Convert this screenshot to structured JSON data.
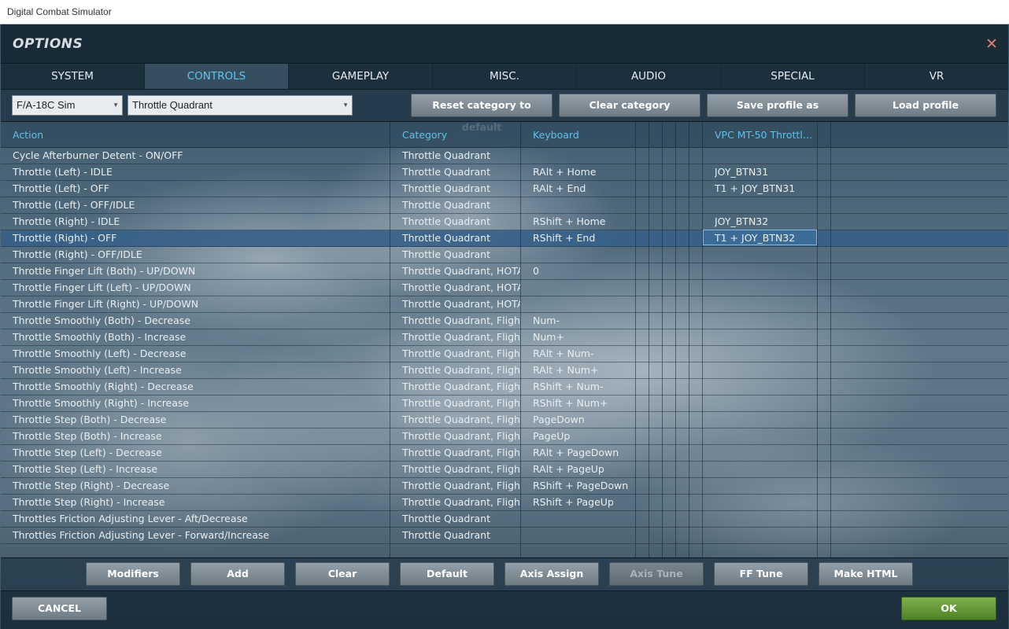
{
  "window_title": "Digital Combat Simulator",
  "dialog": {
    "title": "OPTIONS",
    "close_glyph": "✕"
  },
  "tabs": [
    {
      "label": "SYSTEM",
      "active": false
    },
    {
      "label": "CONTROLS",
      "active": true
    },
    {
      "label": "GAMEPLAY",
      "active": false
    },
    {
      "label": "MISC.",
      "active": false
    },
    {
      "label": "AUDIO",
      "active": false
    },
    {
      "label": "SPECIAL",
      "active": false
    },
    {
      "label": "VR",
      "active": false
    }
  ],
  "toolbar": {
    "aircraft_select": "F/A-18C Sim",
    "category_select": "Throttle Quadrant",
    "reset_label": "Reset category to default",
    "clear_category_label": "Clear category",
    "save_profile_label": "Save profile as",
    "load_profile_label": "Load profile"
  },
  "table": {
    "columns": [
      "Action",
      "Category",
      "Keyboard",
      "VPC MT-50 Throttle ..."
    ],
    "selected_row": 5,
    "rows": [
      [
        "Cycle Afterburner Detent - ON/OFF",
        "Throttle Quadrant",
        "",
        ""
      ],
      [
        "Throttle (Left) - IDLE",
        "Throttle Quadrant",
        "RAlt + Home",
        "JOY_BTN31"
      ],
      [
        "Throttle (Left) - OFF",
        "Throttle Quadrant",
        "RAlt + End",
        "T1 + JOY_BTN31"
      ],
      [
        "Throttle (Left) - OFF/IDLE",
        "Throttle Quadrant",
        "",
        ""
      ],
      [
        "Throttle (Right) - IDLE",
        "Throttle Quadrant",
        "RShift + Home",
        "JOY_BTN32"
      ],
      [
        "Throttle (Right) - OFF",
        "Throttle Quadrant",
        "RShift + End",
        "T1 + JOY_BTN32"
      ],
      [
        "Throttle (Right) - OFF/IDLE",
        "Throttle Quadrant",
        "",
        ""
      ],
      [
        "Throttle Finger Lift (Both) - UP/DOWN",
        "Throttle Quadrant, HOTAS",
        "0",
        ""
      ],
      [
        "Throttle Finger Lift (Left) - UP/DOWN",
        "Throttle Quadrant, HOTAS",
        "",
        ""
      ],
      [
        "Throttle Finger Lift (Right) - UP/DOWN",
        "Throttle Quadrant, HOTAS",
        "",
        ""
      ],
      [
        "Throttle Smoothly (Both) - Decrease",
        "Throttle Quadrant, Flight C",
        "Num-",
        ""
      ],
      [
        "Throttle Smoothly (Both) - Increase",
        "Throttle Quadrant, Flight C",
        "Num+",
        ""
      ],
      [
        "Throttle Smoothly (Left) - Decrease",
        "Throttle Quadrant, Flight C",
        "RAlt + Num-",
        ""
      ],
      [
        "Throttle Smoothly (Left) - Increase",
        "Throttle Quadrant, Flight C",
        "RAlt + Num+",
        ""
      ],
      [
        "Throttle Smoothly (Right) - Decrease",
        "Throttle Quadrant, Flight C",
        "RShift + Num-",
        ""
      ],
      [
        "Throttle Smoothly (Right) - Increase",
        "Throttle Quadrant, Flight C",
        "RShift + Num+",
        ""
      ],
      [
        "Throttle Step (Both) - Decrease",
        "Throttle Quadrant, Flight C",
        "PageDown",
        ""
      ],
      [
        "Throttle Step (Both) - Increase",
        "Throttle Quadrant, Flight C",
        "PageUp",
        ""
      ],
      [
        "Throttle Step (Left) - Decrease",
        "Throttle Quadrant, Flight C",
        "RAlt + PageDown",
        ""
      ],
      [
        "Throttle Step (Left) - Increase",
        "Throttle Quadrant, Flight C",
        "RAlt + PageUp",
        ""
      ],
      [
        "Throttle Step (Right) - Decrease",
        "Throttle Quadrant, Flight C",
        "RShift + PageDown",
        ""
      ],
      [
        "Throttle Step (Right) - Increase",
        "Throttle Quadrant, Flight C",
        "RShift + PageUp",
        ""
      ],
      [
        "Throttles Friction Adjusting Lever - Aft/Decrease",
        "Throttle Quadrant",
        "",
        ""
      ],
      [
        "Throttles Friction Adjusting Lever - Forward/Increase",
        "Throttle Quadrant",
        "",
        ""
      ]
    ]
  },
  "bottom_buttons": [
    {
      "label": "Modifiers",
      "enabled": true
    },
    {
      "label": "Add",
      "enabled": true
    },
    {
      "label": "Clear",
      "enabled": true
    },
    {
      "label": "Default",
      "enabled": true
    },
    {
      "label": "Axis Assign",
      "enabled": true
    },
    {
      "label": "Axis Tune",
      "enabled": false
    },
    {
      "label": "FF Tune",
      "enabled": true
    },
    {
      "label": "Make HTML",
      "enabled": true
    }
  ],
  "footer": {
    "cancel_label": "CANCEL",
    "ok_label": "OK"
  },
  "colors": {
    "accent": "#5ec6ee",
    "ok_button": "#5f9430",
    "selected_row": "#36608a",
    "close_icon": "#e08070"
  }
}
